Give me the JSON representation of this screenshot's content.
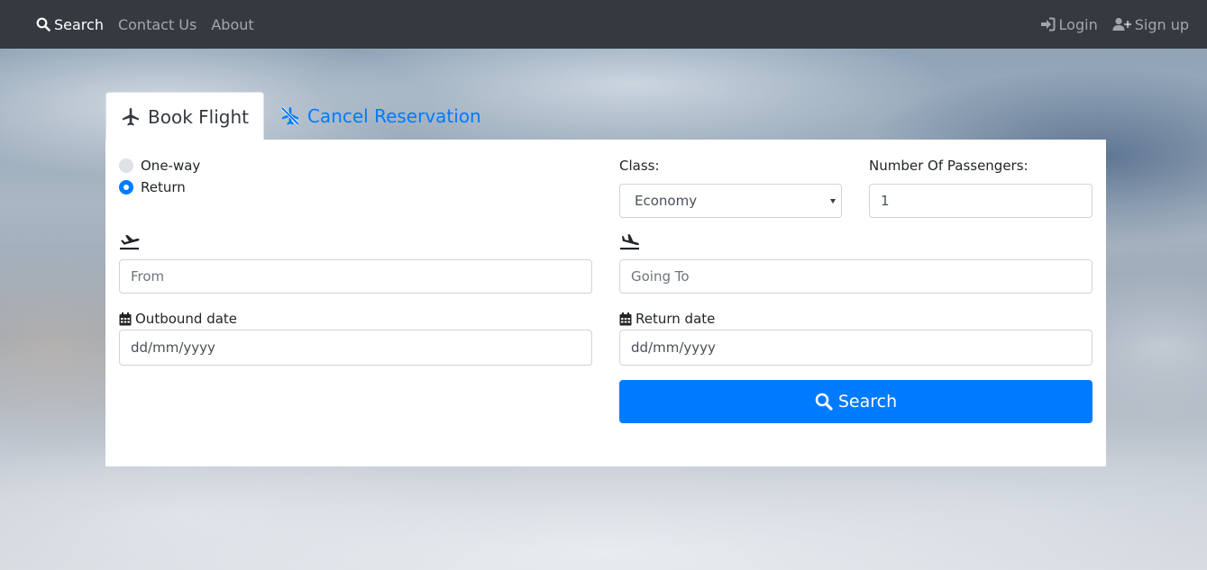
{
  "navbar": {
    "search_label": "Search",
    "contact_label": "Contact Us",
    "about_label": "About",
    "login_label": "Login",
    "signup_label": "Sign up"
  },
  "tabs": {
    "book_flight": "Book Flight",
    "cancel_reservation": "Cancel Reservation"
  },
  "form": {
    "trip_type": {
      "options": [
        "One-way",
        "Return"
      ],
      "selected": "Return"
    },
    "class": {
      "label": "Class:",
      "selected": "Economy"
    },
    "passengers": {
      "label": "Number Of Passengers:",
      "value": "1"
    },
    "from": {
      "placeholder": "From",
      "icon": "plane-departure-icon"
    },
    "to": {
      "placeholder": "Going To",
      "icon": "plane-arrival-icon"
    },
    "outbound_date": {
      "label": "Outbound date",
      "placeholder": "dd/mm/yyyy",
      "icon": "calendar-icon"
    },
    "return_date": {
      "label": "Return date",
      "placeholder": "dd/mm/yyyy",
      "icon": "calendar-icon"
    },
    "search_button": "Search"
  },
  "colors": {
    "navbar_bg": "#343a40",
    "primary": "#007bff",
    "nav_inactive": "rgba(255,255,255,0.55)"
  }
}
